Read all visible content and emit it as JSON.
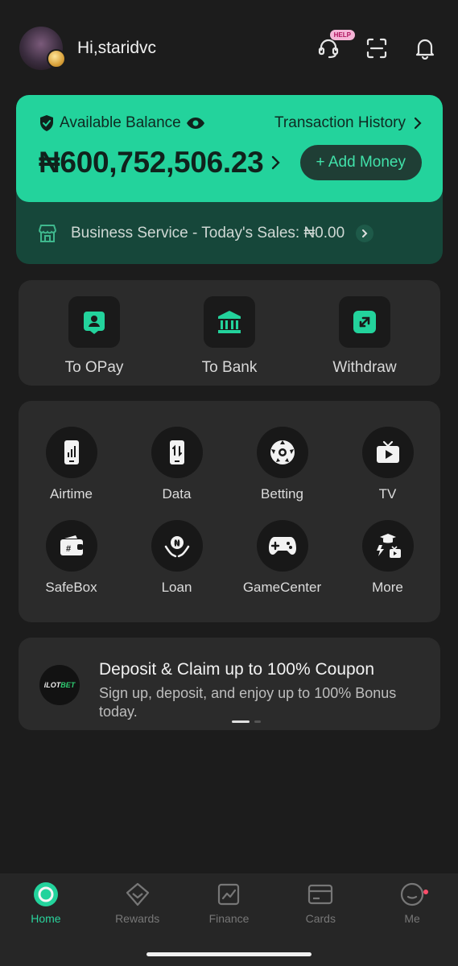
{
  "header": {
    "greeting": "Hi,staridvc",
    "help_badge": "HELP"
  },
  "balance": {
    "label": "Available Balance",
    "history_link": "Transaction History",
    "amount": "₦600,752,506.23",
    "add_money": "+ Add Money",
    "business_text": "Business Service - Today's Sales: ₦0.00"
  },
  "transfers": [
    {
      "label": "To OPay",
      "icon": "user-card-icon"
    },
    {
      "label": "To Bank",
      "icon": "bank-icon"
    },
    {
      "label": "Withdraw",
      "icon": "withdraw-icon"
    }
  ],
  "services": [
    {
      "label": "Airtime",
      "icon": "phone-signal-icon"
    },
    {
      "label": "Data",
      "icon": "phone-data-icon"
    },
    {
      "label": "Betting",
      "icon": "soccer-ball-icon"
    },
    {
      "label": "TV",
      "icon": "tv-icon"
    },
    {
      "label": "SafeBox",
      "icon": "safebox-icon"
    },
    {
      "label": "Loan",
      "icon": "loan-hand-icon"
    },
    {
      "label": "GameCenter",
      "icon": "gamepad-icon"
    },
    {
      "label": "More",
      "icon": "more-apps-icon"
    }
  ],
  "promo": {
    "logo_main": "iLOT",
    "logo_accent": "BET",
    "title": "Deposit & Claim up to 100% Coupon",
    "subtitle": "Sign up, deposit, and enjoy up to 100% Bonus today."
  },
  "nav": [
    {
      "label": "Home",
      "icon": "home-icon",
      "active": true
    },
    {
      "label": "Rewards",
      "icon": "rewards-icon",
      "active": false
    },
    {
      "label": "Finance",
      "icon": "finance-icon",
      "active": false
    },
    {
      "label": "Cards",
      "icon": "cards-icon",
      "active": false
    },
    {
      "label": "Me",
      "icon": "me-icon",
      "active": false
    }
  ],
  "colors": {
    "accent": "#23d39c",
    "background": "#1c1c1c",
    "card": "#2b2b2b"
  }
}
